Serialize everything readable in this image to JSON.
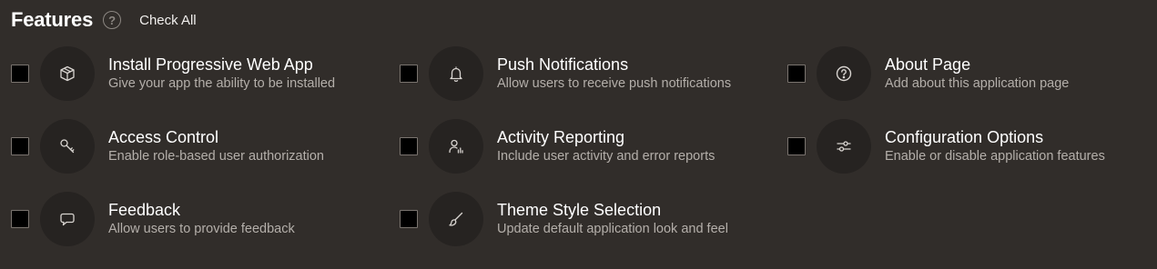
{
  "header": {
    "title": "Features",
    "help_icon": "help-circle-icon",
    "check_all_label": "Check All"
  },
  "features": [
    {
      "id": "pwa",
      "icon": "cube-icon",
      "title": "Install Progressive Web App",
      "description": "Give your app the ability to be installed"
    },
    {
      "id": "push",
      "icon": "bell-icon",
      "title": "Push Notifications",
      "description": "Allow users to receive push notifications"
    },
    {
      "id": "about",
      "icon": "help-circle-icon",
      "title": "About Page",
      "description": "Add about this application page"
    },
    {
      "id": "access",
      "icon": "key-icon",
      "title": "Access Control",
      "description": "Enable role-based user authorization"
    },
    {
      "id": "activity",
      "icon": "user-chart-icon",
      "title": "Activity Reporting",
      "description": "Include user activity and error reports"
    },
    {
      "id": "config",
      "icon": "sliders-icon",
      "title": "Configuration Options",
      "description": "Enable or disable application features"
    },
    {
      "id": "feedback",
      "icon": "chat-bubble-icon",
      "title": "Feedback",
      "description": "Allow users to provide feedback"
    },
    {
      "id": "theme",
      "icon": "brush-icon",
      "title": "Theme Style Selection",
      "description": "Update default application look and feel"
    }
  ],
  "colors": {
    "background": "#312d2a",
    "icon_circle": "#262321",
    "title_text": "#ffffff",
    "description_text": "#b4afaa",
    "icon_stroke": "#d8d4d0"
  }
}
